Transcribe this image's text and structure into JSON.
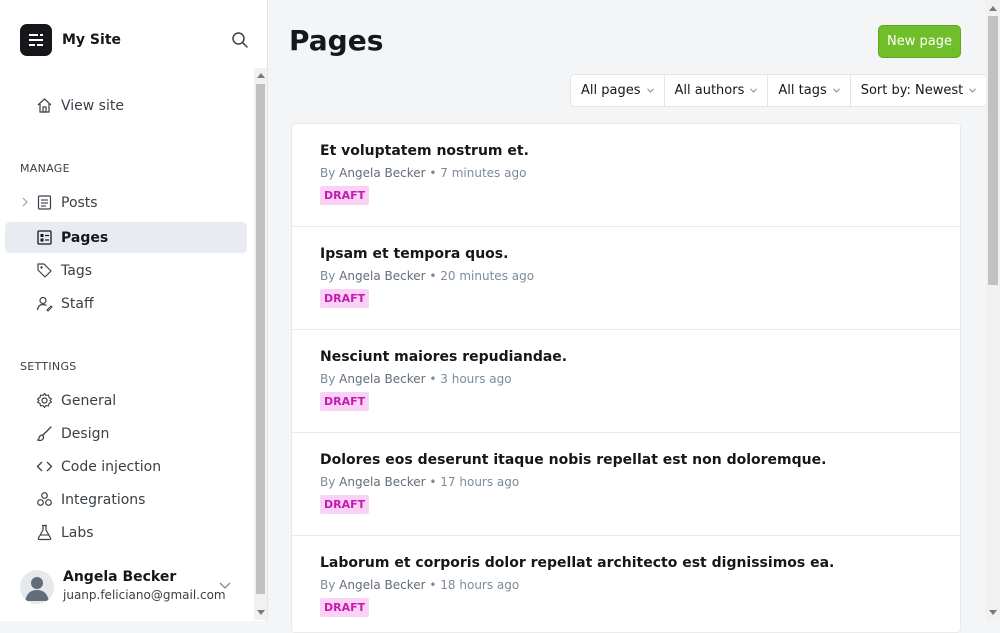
{
  "site": {
    "title": "My Site",
    "logo_icon": "site-logo-icon",
    "search_icon": "search-icon"
  },
  "sidebar": {
    "top_items": [
      {
        "label": "View site",
        "icon": "home-icon"
      }
    ],
    "manage_heading": "MANAGE",
    "manage_items": [
      {
        "label": "Posts",
        "icon": "posts-icon",
        "expandable": true
      },
      {
        "label": "Pages",
        "icon": "pages-icon",
        "active": true
      },
      {
        "label": "Tags",
        "icon": "tag-icon"
      },
      {
        "label": "Staff",
        "icon": "staff-icon"
      }
    ],
    "settings_heading": "SETTINGS",
    "settings_items": [
      {
        "label": "General",
        "icon": "gear-icon"
      },
      {
        "label": "Design",
        "icon": "brush-icon"
      },
      {
        "label": "Code injection",
        "icon": "code-icon"
      },
      {
        "label": "Integrations",
        "icon": "integrations-icon"
      },
      {
        "label": "Labs",
        "icon": "flask-icon"
      }
    ],
    "user": {
      "name": "Angela Becker",
      "email": "juanp.feliciano@gmail.com"
    }
  },
  "main": {
    "title": "Pages",
    "new_button": "New page",
    "filters": [
      {
        "label": "All pages"
      },
      {
        "label": "All authors"
      },
      {
        "label": "All tags"
      },
      {
        "label": "Sort by: Newest"
      }
    ],
    "pages": [
      {
        "title": "Et voluptatem nostrum et.",
        "author": "Angela Becker",
        "time": "7 minutes ago",
        "status": "DRAFT"
      },
      {
        "title": "Ipsam et tempora quos.",
        "author": "Angela Becker",
        "time": "20 minutes ago",
        "status": "DRAFT"
      },
      {
        "title": "Nesciunt maiores repudiandae.",
        "author": "Angela Becker",
        "time": "3 hours ago",
        "status": "DRAFT"
      },
      {
        "title": "Dolores eos deserunt itaque nobis repellat est non doloremque.",
        "author": "Angela Becker",
        "time": "17 hours ago",
        "status": "DRAFT"
      },
      {
        "title": "Laborum et corporis dolor repellat architecto est dignissimos ea.",
        "author": "Angela Becker",
        "time": "18 hours ago",
        "status": "DRAFT"
      }
    ],
    "meta_by": "By",
    "meta_sep": "•"
  },
  "colors": {
    "accent": "#6fbe2a",
    "draft_bg": "#fad2f5",
    "draft_text": "#c51ab1",
    "active_nav": "#e8ebf2"
  }
}
